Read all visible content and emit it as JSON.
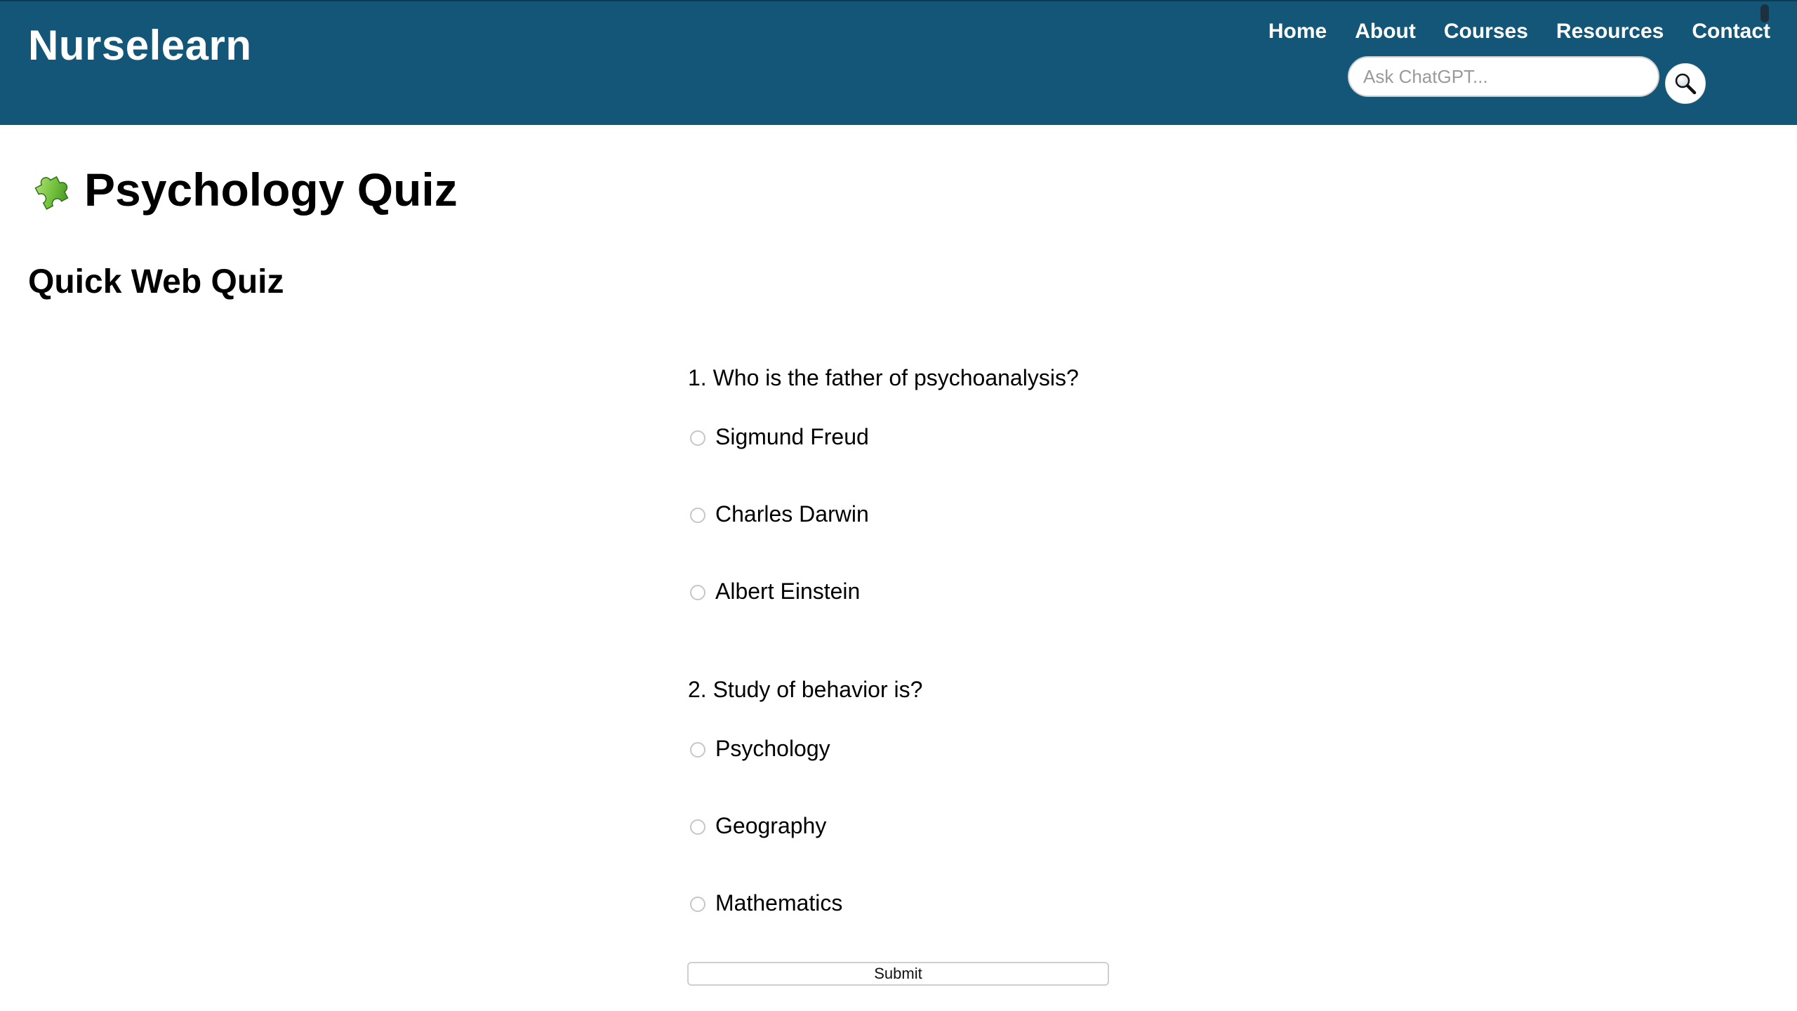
{
  "header": {
    "brand": "Nurselearn",
    "nav": [
      "Home",
      "About",
      "Courses",
      "Resources",
      "Contact"
    ],
    "search": {
      "placeholder": "Ask ChatGPT...",
      "value": "",
      "button_icon": "search-icon"
    },
    "colors": {
      "background": "#135677",
      "text": "#ffffff"
    }
  },
  "page": {
    "title_icon": "puzzle-piece-icon",
    "title": "Psychology Quiz",
    "subtitle": "Quick Web Quiz"
  },
  "quiz": {
    "questions": [
      {
        "text": "1. Who is the father of psychoanalysis?",
        "options": [
          "Sigmund Freud",
          "Charles Darwin",
          "Albert Einstein"
        ]
      },
      {
        "text": "2. Study of behavior is?",
        "options": [
          "Psychology",
          "Geography",
          "Mathematics"
        ]
      }
    ],
    "submit_label": "Submit"
  }
}
